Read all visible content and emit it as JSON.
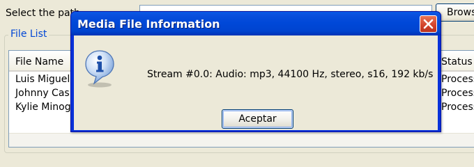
{
  "background": {
    "select_label": "Select the path",
    "browse_label": "Browse",
    "group_title": "File List",
    "columns": {
      "name": "File Name",
      "status": "Status"
    },
    "rows": [
      {
        "name": "Luis Miguel",
        "status": "Processed"
      },
      {
        "name": "Johnny Cash",
        "status": "Processed"
      },
      {
        "name": "Kylie Minogue",
        "status": "Processed"
      }
    ]
  },
  "dialog": {
    "title": "Media File Information",
    "message": "Stream #0.0: Audio: mp3, 44100 Hz, stereo, s16, 192 kb/s",
    "ok_label": "Aceptar",
    "icon": "info-icon"
  },
  "colors": {
    "titlebar": "#0044d0",
    "close_button": "#d2422a",
    "group_title": "#0046d5",
    "window_face": "#ece9d8"
  }
}
